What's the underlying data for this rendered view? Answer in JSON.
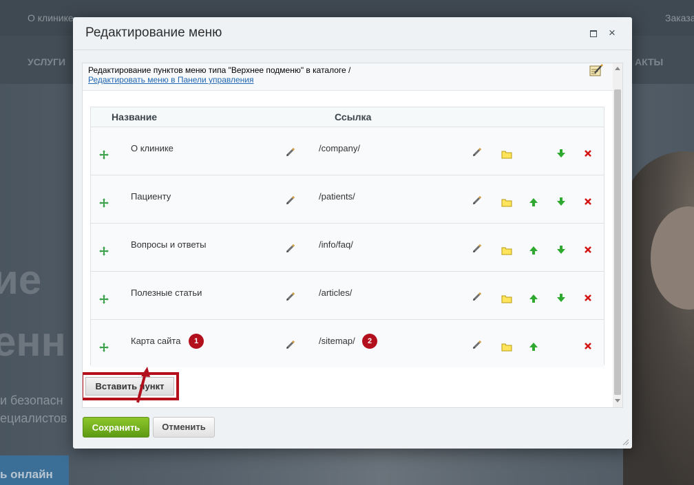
{
  "background": {
    "top_left_text": "О клинике",
    "top_right_text": "Заказа",
    "nav_left": "УСЛУГИ",
    "nav_right": "АКТЫ",
    "hero_big_1": "ие",
    "hero_big_2": "енн",
    "hero_small_1": "и безопасн",
    "hero_small_2": "ециалистов",
    "online_button": "ь онлайн"
  },
  "dialog": {
    "title": "Редактирование меню",
    "info_text": "Редактирование пунктов меню типа \"Верхнее подменю\" в каталоге /",
    "info_link": "Редактировать меню в Панели управления",
    "columns": {
      "name": "Название",
      "link": "Ссылка"
    },
    "rows": [
      {
        "name": "О клинике",
        "link": "/company/",
        "can_up": false,
        "can_down": true
      },
      {
        "name": "Пациенту",
        "link": "/patients/",
        "can_up": true,
        "can_down": true
      },
      {
        "name": "Вопросы и ответы",
        "link": "/info/faq/",
        "can_up": true,
        "can_down": true
      },
      {
        "name": "Полезные статьи",
        "link": "/articles/",
        "can_up": true,
        "can_down": true
      },
      {
        "name": "Карта сайта",
        "link": "/sitemap/",
        "can_up": true,
        "can_down": false
      }
    ],
    "badges": {
      "name": "1",
      "link": "2"
    },
    "insert_button": "Вставить пункт",
    "save_button": "Сохранить",
    "cancel_button": "Отменить"
  },
  "colors": {
    "accent_red": "#b2101c",
    "save_green": "#6fae1c",
    "link_blue": "#2067b0"
  }
}
